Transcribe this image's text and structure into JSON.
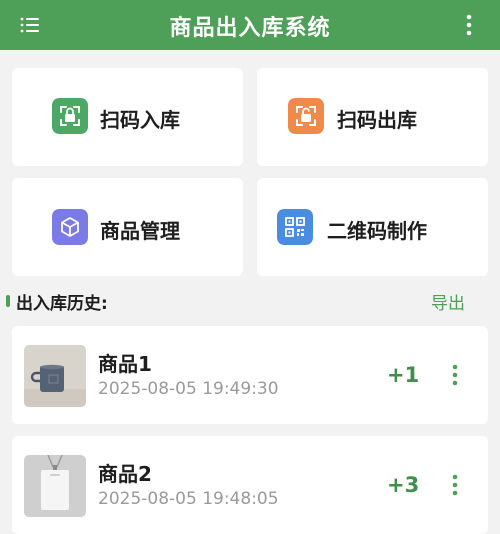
{
  "app": {
    "title": "商品出入库系统"
  },
  "colors": {
    "brand": "#4e9f58",
    "scan_in": "#4ca865",
    "scan_out": "#f08a4b",
    "product_mgmt": "#7a7be6",
    "qrcode": "#4a8de0"
  },
  "actions": [
    {
      "label": "扫码入库",
      "icon": "scan-in-icon"
    },
    {
      "label": "扫码出库",
      "icon": "scan-out-icon"
    },
    {
      "label": "商品管理",
      "icon": "box-icon"
    },
    {
      "label": "二维码制作",
      "icon": "qrcode-icon"
    }
  ],
  "history": {
    "title": "出入库历史:",
    "export_label": "导出",
    "records": [
      {
        "name": "商品1",
        "time": "2025-08-05 19:49:30",
        "qty": "+1",
        "thumb": "mug-photo"
      },
      {
        "name": "商品2",
        "time": "2025-08-05 19:48:05",
        "qty": "+3",
        "thumb": "badge-photo"
      }
    ]
  }
}
